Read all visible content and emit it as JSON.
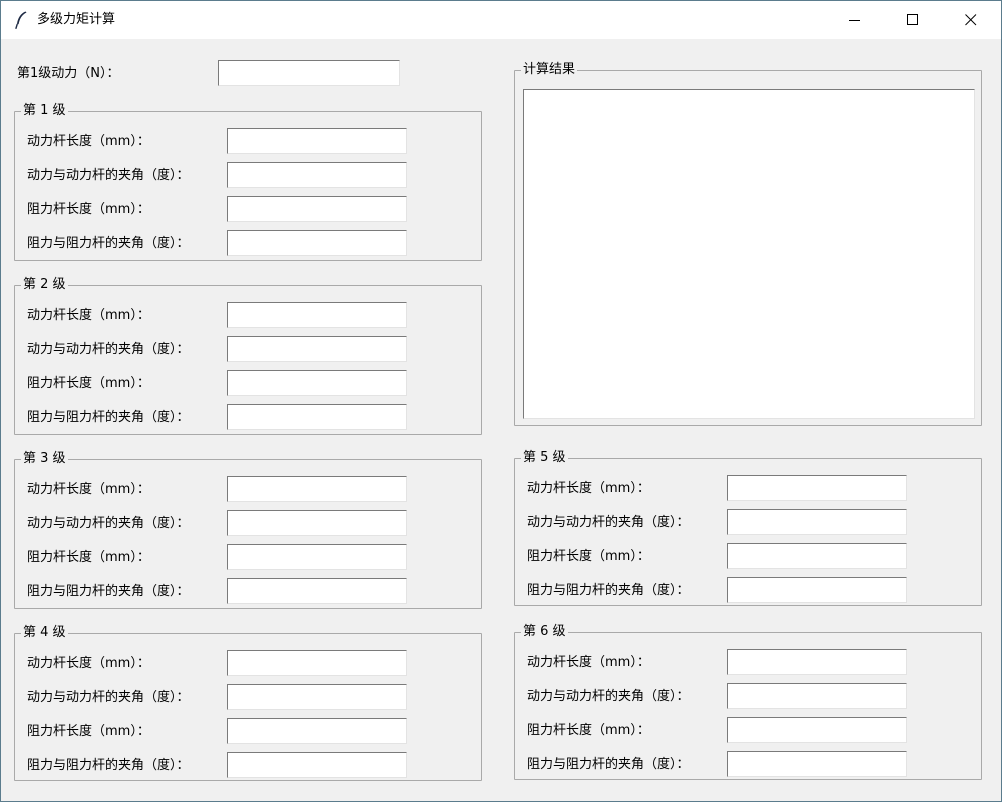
{
  "window": {
    "title": "多级力矩计算",
    "icon": "feather-icon",
    "controls": [
      "minimize-icon",
      "maximize-icon",
      "close-icon"
    ]
  },
  "first_force": {
    "label": "第1级动力（N）：",
    "value": ""
  },
  "field_labels": {
    "effort_arm": "动力杆长度（mm）：",
    "effort_angle": "动力与动力杆的夹角（度）：",
    "resist_arm": "阻力杆长度（mm）：",
    "resist_angle": "阻力与阻力杆的夹角（度）："
  },
  "stages": [
    {
      "title": "第 1 级",
      "effort_arm": "",
      "effort_angle": "",
      "resist_arm": "",
      "resist_angle": ""
    },
    {
      "title": "第 2 级",
      "effort_arm": "",
      "effort_angle": "",
      "resist_arm": "",
      "resist_angle": ""
    },
    {
      "title": "第 3 级",
      "effort_arm": "",
      "effort_angle": "",
      "resist_arm": "",
      "resist_angle": ""
    },
    {
      "title": "第 4 级",
      "effort_arm": "",
      "effort_angle": "",
      "resist_arm": "",
      "resist_angle": ""
    },
    {
      "title": "第 5 级",
      "effort_arm": "",
      "effort_angle": "",
      "resist_arm": "",
      "resist_angle": ""
    },
    {
      "title": "第 6 级",
      "effort_arm": "",
      "effort_angle": "",
      "resist_arm": "",
      "resist_angle": ""
    }
  ],
  "results": {
    "title": "计算结果",
    "text": ""
  }
}
